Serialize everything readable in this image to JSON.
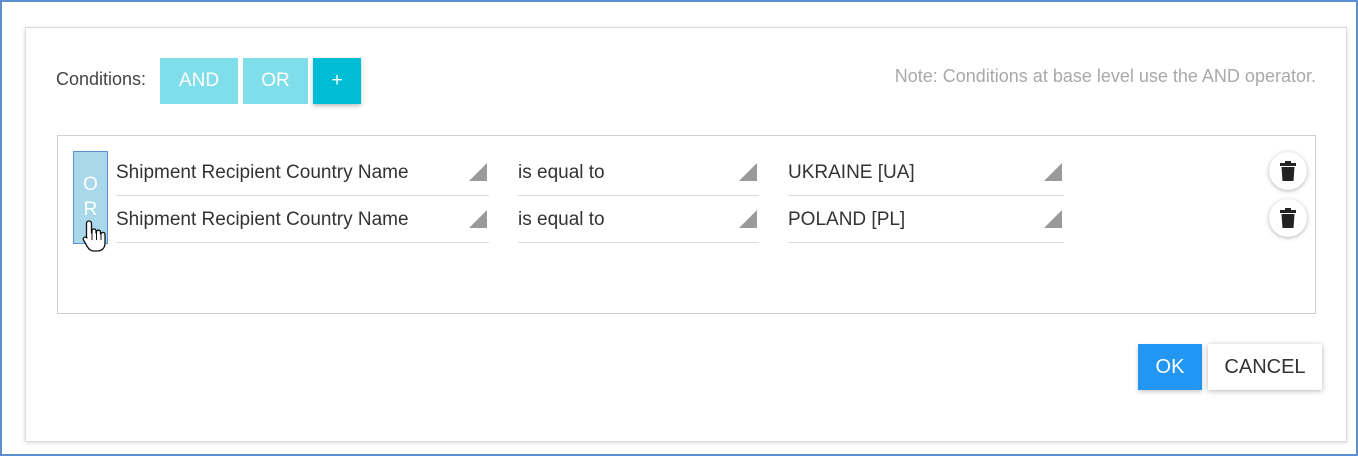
{
  "toolbar": {
    "conditions_label": "Conditions:",
    "and_label": "AND",
    "or_label": "OR",
    "add_label": "+"
  },
  "note": "Note: Conditions at base level use the AND operator.",
  "group": {
    "operator_letters": [
      "O",
      "R"
    ],
    "conditions": [
      {
        "field": "Shipment Recipient Country Name",
        "operator": "is equal to",
        "value": "UKRAINE [UA]"
      },
      {
        "field": "Shipment Recipient Country Name",
        "operator": "is equal to",
        "value": "POLAND [PL]"
      }
    ]
  },
  "footer": {
    "ok_label": "OK",
    "cancel_label": "CANCEL"
  },
  "colors": {
    "logic_button": "#80deea",
    "add_button": "#00bcd4",
    "group_bar": "#a8d8ea",
    "ok_button": "#2196f3",
    "window_border": "#5b8fd0"
  },
  "icons": [
    "trash-icon",
    "hand-cursor-icon",
    "dropdown-caret-icon"
  ]
}
